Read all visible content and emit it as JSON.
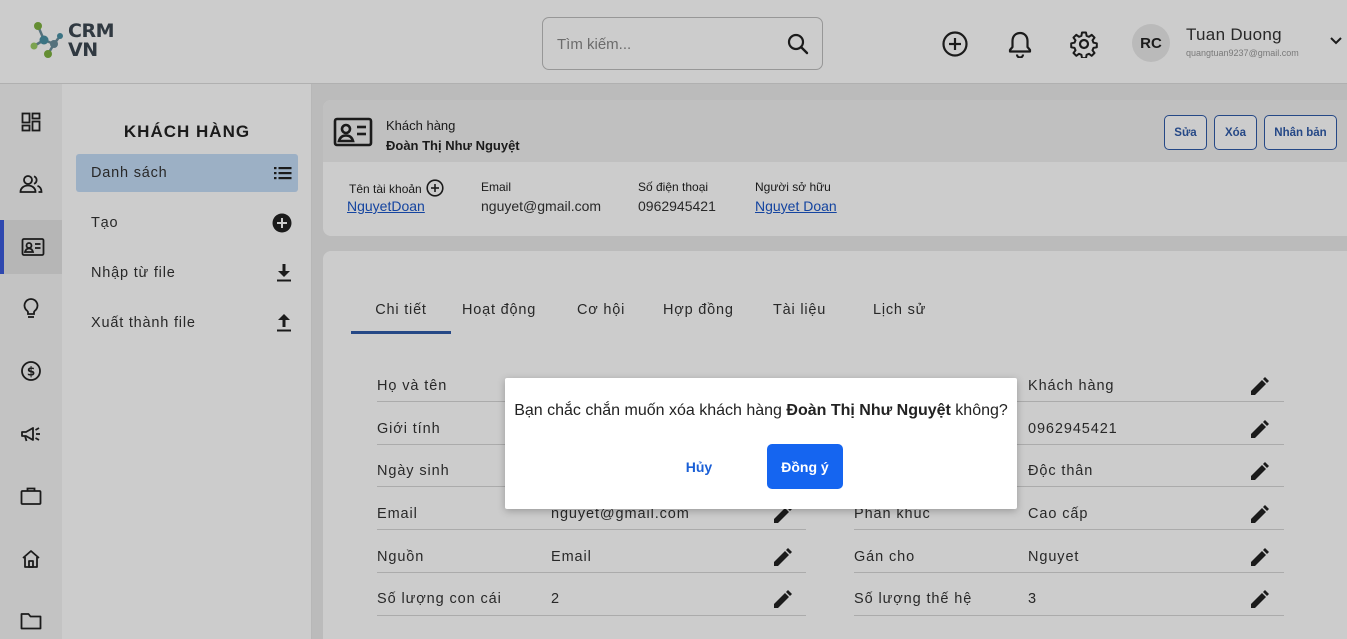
{
  "header": {
    "logo_line1": "CRM",
    "logo_line2": "VN",
    "search_placeholder": "Tìm kiếm...",
    "user_initials": "RC",
    "user_name": "Tuan Duong",
    "user_email": "quangtuan9237@gmail.com"
  },
  "rail": {
    "items": [
      "dashboard-icon",
      "contacts-icon",
      "customer-card-icon",
      "lightbulb-icon",
      "dollar-icon",
      "megaphone-icon",
      "briefcase-icon",
      "home-icon",
      "folder-icon"
    ],
    "active": "customer-card-icon",
    "accent": "#3b5bdb"
  },
  "sidebar": {
    "title": "KHÁCH HÀNG",
    "items": [
      {
        "label": "Danh sách",
        "icon": "list-icon"
      },
      {
        "label": "Tạo",
        "icon": "add-circle-icon"
      },
      {
        "label": "Nhập từ file",
        "icon": "download-icon"
      },
      {
        "label": "Xuất thành file",
        "icon": "upload-icon"
      }
    ]
  },
  "record": {
    "type": "Khách hàng",
    "name": "Đoàn Thị Như Nguyệt",
    "btn_edit": "Sửa",
    "btn_delete": "Xóa",
    "btn_clone": "Nhân bản",
    "meta": {
      "account_label": "Tên tài khoản",
      "account_value": "NguyetDoan",
      "email_label": "Email",
      "email_value": "nguyet@gmail.com",
      "phone_label": "Số điện thoại",
      "phone_value": "0962945421",
      "owner_label": "Người sở hữu",
      "owner_value": "Nguyet Doan"
    }
  },
  "tabs": [
    "Chi tiết",
    "Hoạt động",
    "Cơ hội",
    "Hợp đồng",
    "Tài liệu",
    "Lịch sử"
  ],
  "fields_left": [
    {
      "label": "Họ và tên",
      "value": ""
    },
    {
      "label": "Giới tính",
      "value": ""
    },
    {
      "label": "Ngày sinh",
      "value": ""
    },
    {
      "label": "Email",
      "value": "nguyet@gmail.com"
    },
    {
      "label": "Nguồn",
      "value": "Email"
    },
    {
      "label": "Số lượng con cái",
      "value": "2"
    }
  ],
  "fields_right": [
    {
      "label": "",
      "value": "Khách hàng"
    },
    {
      "label": "",
      "value": "0962945421"
    },
    {
      "label": "",
      "value": "Độc thân"
    },
    {
      "label": "Phân khúc",
      "value": "Cao cấp"
    },
    {
      "label": "Gán cho",
      "value": "Nguyet"
    },
    {
      "label": "Số lượng thế hệ",
      "value": "3"
    }
  ],
  "modal": {
    "msg_before": "Bạn chắc chắn muốn xóa khách hàng ",
    "msg_name": "Đoàn Thị Như Nguyệt",
    "msg_after": " không?",
    "cancel": "Hủy",
    "confirm": "Đồng ý",
    "confirm_color": "#1565f0"
  }
}
